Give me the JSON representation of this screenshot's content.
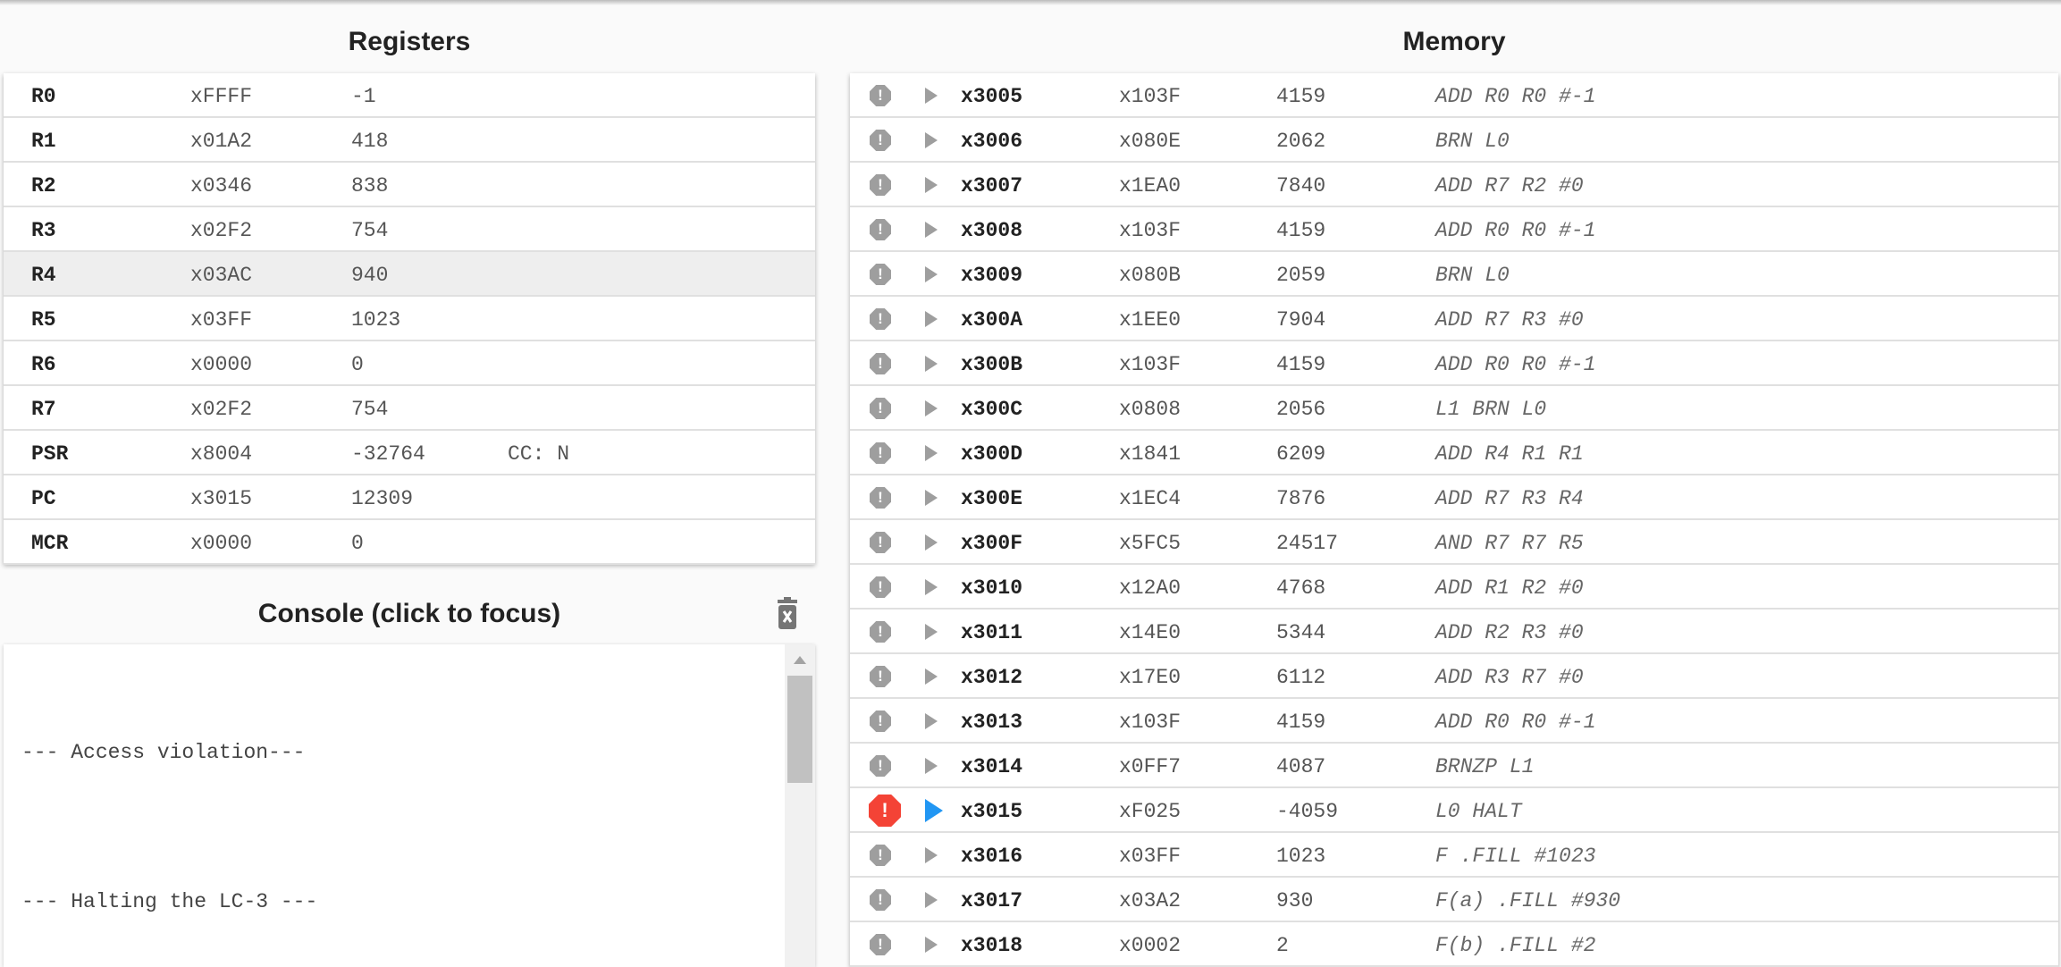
{
  "registers": {
    "title": "Registers",
    "rows": [
      {
        "name": "R0",
        "hex": "xFFFF",
        "dec": "-1",
        "extra": ""
      },
      {
        "name": "R1",
        "hex": "x01A2",
        "dec": "418",
        "extra": ""
      },
      {
        "name": "R2",
        "hex": "x0346",
        "dec": "838",
        "extra": ""
      },
      {
        "name": "R3",
        "hex": "x02F2",
        "dec": "754",
        "extra": ""
      },
      {
        "name": "R4",
        "hex": "x03AC",
        "dec": "940",
        "extra": ""
      },
      {
        "name": "R5",
        "hex": "x03FF",
        "dec": "1023",
        "extra": ""
      },
      {
        "name": "R6",
        "hex": "x0000",
        "dec": "0",
        "extra": ""
      },
      {
        "name": "R7",
        "hex": "x02F2",
        "dec": "754",
        "extra": ""
      },
      {
        "name": "PSR",
        "hex": "x8004",
        "dec": "-32764",
        "extra": "CC: N"
      },
      {
        "name": "PC",
        "hex": "x3015",
        "dec": "12309",
        "extra": ""
      },
      {
        "name": "MCR",
        "hex": "x0000",
        "dec": "0",
        "extra": ""
      }
    ],
    "highlighted_row": "R4"
  },
  "console": {
    "title": "Console (click to focus)",
    "clear_icon": "trash-x-icon",
    "lines": [
      "--- Access violation---",
      "--- Halting the LC-3 ---"
    ]
  },
  "memory": {
    "title": "Memory",
    "current_address": "x3015",
    "colors": {
      "breakpoint_inactive": "#9e9e9e",
      "breakpoint_active": "#f44336",
      "pc_arrow": "#2196f3"
    },
    "rows": [
      {
        "addr": "x3005",
        "hex": "x103F",
        "dec": "4159",
        "instr": "ADD R0 R0 #-1"
      },
      {
        "addr": "x3006",
        "hex": "x080E",
        "dec": "2062",
        "instr": "BRN L0"
      },
      {
        "addr": "x3007",
        "hex": "x1EA0",
        "dec": "7840",
        "instr": "ADD R7 R2 #0"
      },
      {
        "addr": "x3008",
        "hex": "x103F",
        "dec": "4159",
        "instr": "ADD R0 R0 #-1"
      },
      {
        "addr": "x3009",
        "hex": "x080B",
        "dec": "2059",
        "instr": "BRN L0"
      },
      {
        "addr": "x300A",
        "hex": "x1EE0",
        "dec": "7904",
        "instr": "ADD R7 R3 #0"
      },
      {
        "addr": "x300B",
        "hex": "x103F",
        "dec": "4159",
        "instr": "ADD R0 R0 #-1"
      },
      {
        "addr": "x300C",
        "hex": "x0808",
        "dec": "2056",
        "instr": "L1 BRN L0"
      },
      {
        "addr": "x300D",
        "hex": "x1841",
        "dec": "6209",
        "instr": "ADD R4 R1 R1"
      },
      {
        "addr": "x300E",
        "hex": "x1EC4",
        "dec": "7876",
        "instr": "ADD R7 R3 R4"
      },
      {
        "addr": "x300F",
        "hex": "x5FC5",
        "dec": "24517",
        "instr": "AND R7 R7 R5"
      },
      {
        "addr": "x3010",
        "hex": "x12A0",
        "dec": "4768",
        "instr": "ADD R1 R2 #0"
      },
      {
        "addr": "x3011",
        "hex": "x14E0",
        "dec": "5344",
        "instr": "ADD R2 R3 #0"
      },
      {
        "addr": "x3012",
        "hex": "x17E0",
        "dec": "6112",
        "instr": "ADD R3 R7 #0"
      },
      {
        "addr": "x3013",
        "hex": "x103F",
        "dec": "4159",
        "instr": "ADD R0 R0 #-1"
      },
      {
        "addr": "x3014",
        "hex": "x0FF7",
        "dec": "4087",
        "instr": "BRNZP L1"
      },
      {
        "addr": "x3015",
        "hex": "xF025",
        "dec": "-4059",
        "instr": "L0 HALT"
      },
      {
        "addr": "x3016",
        "hex": "x03FF",
        "dec": "1023",
        "instr": "F .FILL #1023"
      },
      {
        "addr": "x3017",
        "hex": "x03A2",
        "dec": "930",
        "instr": "F(a) .FILL #930"
      },
      {
        "addr": "x3018",
        "hex": "x0002",
        "dec": "2",
        "instr": "F(b) .FILL #2"
      }
    ]
  }
}
